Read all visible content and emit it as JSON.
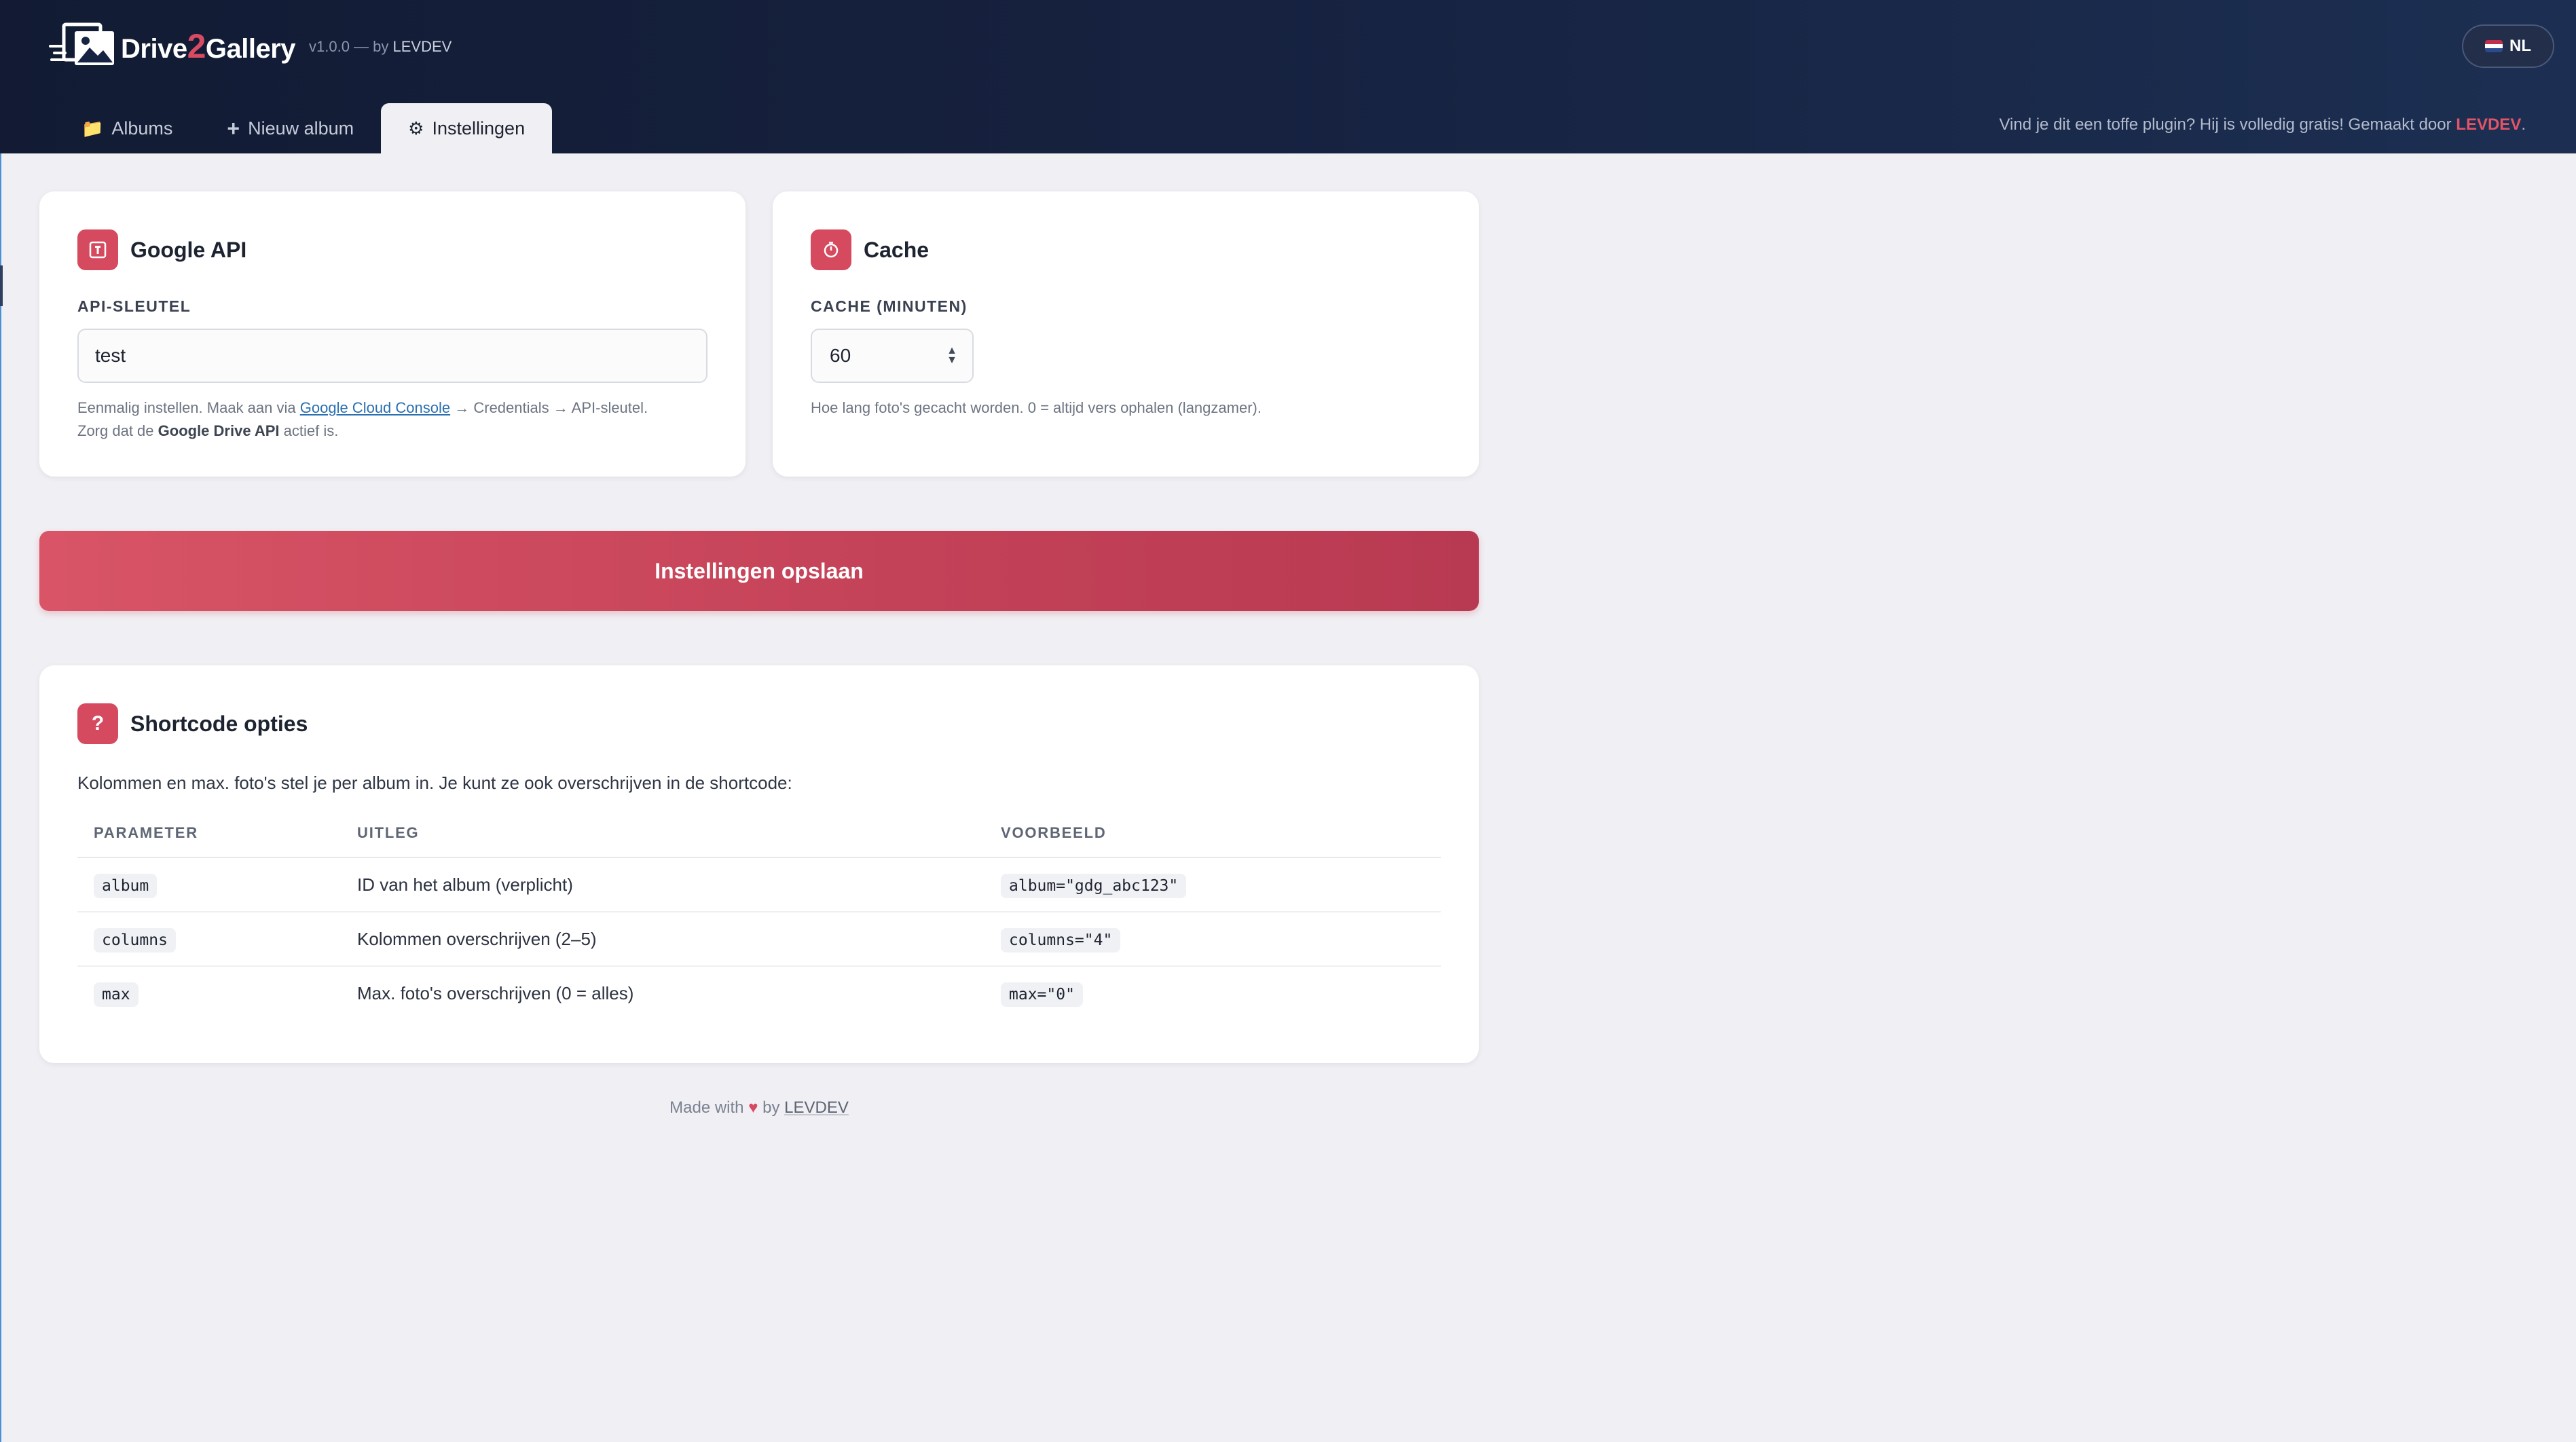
{
  "app": {
    "name_part1": "Drive",
    "name_part2": "2",
    "name_part3": "Gallery",
    "version": "v1.0.0 — by",
    "author": "LEVDEV",
    "language": "NL",
    "brand_color": "#d64a60"
  },
  "tabs": [
    {
      "label": "Albums",
      "icon": "folder-icon",
      "active": false
    },
    {
      "label": "Nieuw album",
      "icon": "plus-icon",
      "active": false
    },
    {
      "label": "Instellingen",
      "icon": "gear-icon",
      "active": true
    }
  ],
  "promo": {
    "text": "Vind je dit een toffe plugin? Hij is volledig gratis! Gemaakt door",
    "link": "LEVDEV",
    "end": "."
  },
  "google_api": {
    "title": "Google API",
    "icon": "key-icon",
    "field_label": "API-SLEUTEL",
    "value": "test",
    "help_pre": "Eenmalig instellen. Maak aan via",
    "help_link": "Google Cloud Console",
    "help_mid": "→ Credentials → API-sleutel.",
    "help_line2_pre": "Zorg dat de",
    "help_line2_bold": "Google Drive API",
    "help_line2_post": "actief is."
  },
  "cache": {
    "title": "Cache",
    "icon": "timer-icon",
    "field_label": "CACHE (MINUTEN)",
    "value": "60",
    "help": "Hoe lang foto's gecacht worden. 0 = altijd vers ophalen (langzamer)."
  },
  "save_button": "Instellingen opslaan",
  "shortcode": {
    "title": "Shortcode opties",
    "icon": "question-icon",
    "description": "Kolommen en max. foto's stel je per album in. Je kunt ze ook overschrijven in de shortcode:",
    "headers": [
      "PARAMETER",
      "UITLEG",
      "VOORBEELD"
    ],
    "rows": [
      {
        "param": "album",
        "desc": "ID van het album (verplicht)",
        "example": "album=\"gdg_abc123\""
      },
      {
        "param": "columns",
        "desc": "Kolommen overschrijven (2–5)",
        "example": "columns=\"4\""
      },
      {
        "param": "max",
        "desc": "Max. foto's overschrijven (0 = alles)",
        "example": "max=\"0\""
      }
    ]
  },
  "footer": {
    "made_with": "Made with",
    "heart": "♥",
    "by": "by",
    "author": "LEVDEV"
  }
}
